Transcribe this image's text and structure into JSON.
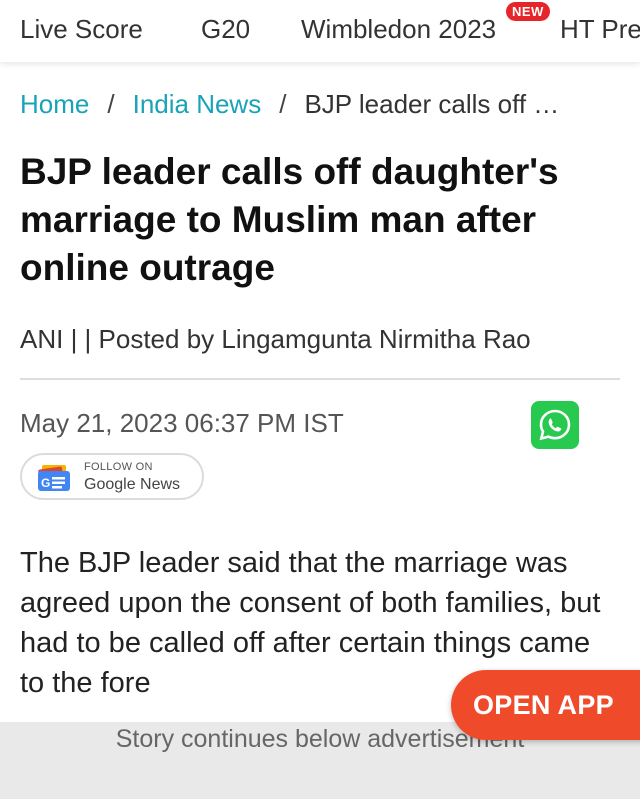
{
  "topnav": {
    "items": [
      "Live Score",
      "G20",
      "Wimbledon 2023",
      "HT Premium"
    ],
    "new_badge": "NEW"
  },
  "breadcrumb": {
    "home": "Home",
    "section": "India News",
    "separator": "/",
    "current": "BJP leader calls off …"
  },
  "article": {
    "headline": "BJP leader calls off daughter's marriage to Muslim man after online outrage",
    "byline": "ANI | | Posted by Lingamgunta Nirmitha Rao",
    "date": "May 21, 2023 06:37 PM IST",
    "body": "The BJP leader said that the marriage was agreed upon the consent of both families, but had to be called off after certain things came to the fore"
  },
  "google_news": {
    "follow_label": "FOLLOW ON",
    "name": "Google News"
  },
  "share": {
    "whatsapp_icon": "whatsapp-icon"
  },
  "ad": {
    "label": "Story continues below advertisement"
  },
  "cta": {
    "open_app": "OPEN APP"
  },
  "colors": {
    "link": "#1aa3b8",
    "badge": "#e5252a",
    "cta": "#ef4b2b",
    "whatsapp": "#27c94f"
  }
}
